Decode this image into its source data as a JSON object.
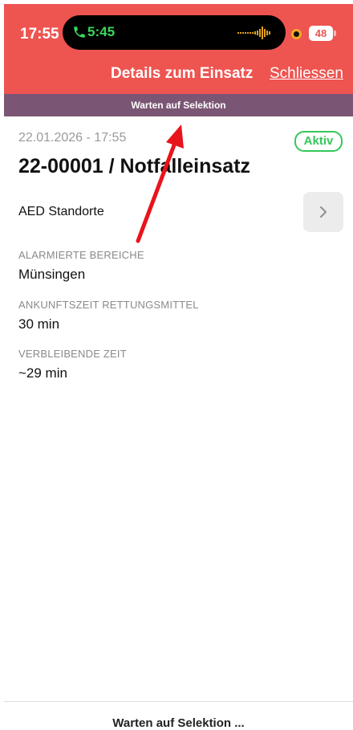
{
  "status_bar": {
    "time": "17:55",
    "call_time": "5:45",
    "battery": "48",
    "icons": [
      "phone-icon",
      "audio-wave-icon",
      "recording-dot-icon",
      "battery-icon"
    ]
  },
  "nav": {
    "title": "Details zum Einsatz",
    "close_label": "Schliessen"
  },
  "sub_bar": {
    "text": "Warten auf Selektion"
  },
  "incident": {
    "date": "22.01.2026 - 17:55",
    "status": "Aktiv",
    "title": "22-00001 / Notfalleinsatz",
    "aed_label": "AED Standorte"
  },
  "fields": [
    {
      "label": "ALARMIERTE BEREICHE",
      "value": "Münsingen"
    },
    {
      "label": "ANKUNFTSZEIT RETTUNGSMITTEL",
      "value": "30 min"
    },
    {
      "label": "VERBLEIBENDE ZEIT",
      "value": "~29 min"
    }
  ],
  "footer": {
    "text": "Warten auf Selektion ..."
  },
  "colors": {
    "header": "#ee5450",
    "sub_bar": "#7b5674",
    "status_active": "#34c759",
    "call_green": "#39d95b",
    "annotation_arrow": "#e8141c"
  }
}
